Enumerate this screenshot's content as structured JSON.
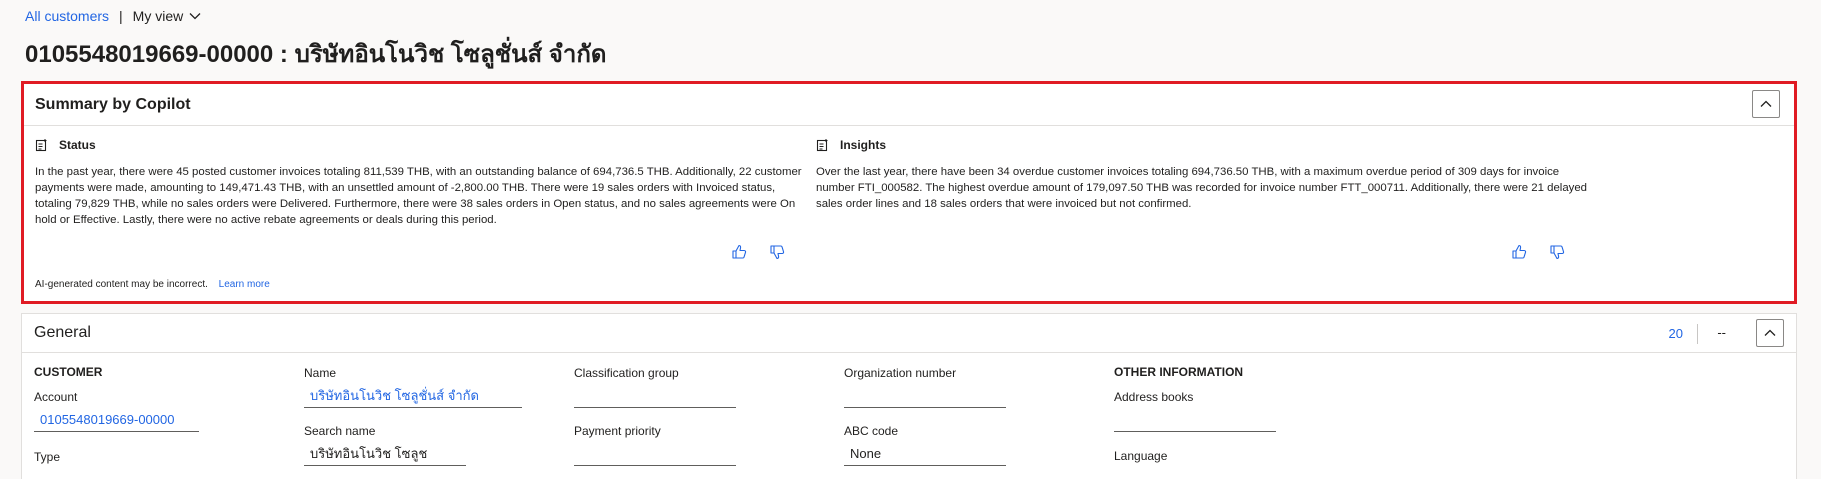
{
  "breadcrumb": {
    "all_customers": "All customers",
    "separator": "|",
    "view": "My view"
  },
  "page_title": "0105548019669-00000 : บริษัทอินโนวิช โซลูชั่นส์ จำกัด",
  "copilot": {
    "title": "Summary by Copilot",
    "status_heading": "Status",
    "status_text": "In the past year, there were 45 posted customer invoices totaling 811,539 THB, with an outstanding balance of 694,736.5 THB. Additionally, 22 customer payments were made, amounting to 149,471.43 THB, with an unsettled amount of -2,800.00 THB. There were 19 sales orders with Invoiced status, totaling 79,829 THB, while no sales orders were Delivered. Furthermore, there were 38 sales orders in Open status, and no sales agreements were On hold or Effective. Lastly, there were no active rebate agreements or deals during this period.",
    "insights_heading": "Insights",
    "insights_text": "Over the last year, there have been 34 overdue customer invoices totaling 694,736.50 THB, with a maximum overdue period of 309 days for invoice number FTI_000582. The highest overdue amount of 179,097.50 THB was recorded for invoice number FTT_000711. Additionally, there were 21 delayed sales order lines and 18 sales orders that were invoiced but not confirmed.",
    "disclaimer": "AI-generated content may be incorrect.",
    "learn_more": "Learn more"
  },
  "general": {
    "title": "General",
    "count": "20",
    "dash": "--",
    "customer_group": "CUSTOMER",
    "account_label": "Account",
    "account_value": "0105548019669-00000",
    "type_label": "Type",
    "name_label": "Name",
    "name_value": "บริษัทอินโนวิช โซลูชั่นส์ จำกัด",
    "search_name_label": "Search name",
    "search_name_value": "บริษัทอินโนวิช โซลูช",
    "classification_label": "Classification group",
    "classification_value": "",
    "payment_priority_label": "Payment priority",
    "payment_priority_value": "",
    "org_number_label": "Organization number",
    "org_number_value": "",
    "abc_code_label": "ABC code",
    "abc_code_value": "None",
    "other_group": "OTHER INFORMATION",
    "address_books_label": "Address books",
    "address_books_value": "",
    "language_label": "Language"
  },
  "icons": [
    "chevron-down-icon",
    "chevron-up-icon",
    "summary-note-icon",
    "thumbs-up-icon",
    "thumbs-down-icon"
  ],
  "colors": {
    "accent": "#2266e3",
    "highlight_border": "#e01b24",
    "background": "#faf9f8"
  }
}
